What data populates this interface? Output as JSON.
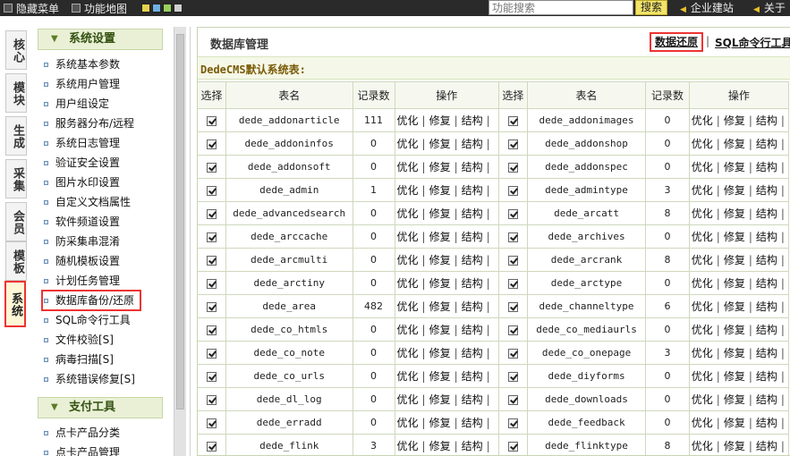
{
  "topbar": {
    "hide_menu": "隐藏菜单",
    "function_map": "功能地图",
    "search_placeholder": "功能搜索",
    "search_button": "搜索",
    "enterprise": "企业建站",
    "about": "关于"
  },
  "vtabs": [
    "核心",
    "模块",
    "生成",
    "采集",
    "会员",
    "模板",
    "系统"
  ],
  "active_vtab": "系统",
  "menu": {
    "section1": "系统设置",
    "items": [
      "系统基本参数",
      "系统用户管理",
      "用户组设定",
      "服务器分布/远程",
      "系统日志管理",
      "验证安全设置",
      "图片水印设置",
      "自定义文档属性",
      "软件频道设置",
      "防采集串混淆",
      "随机模板设置",
      "计划任务管理",
      "数据库备份/还原",
      "SQL命令行工具",
      "文件校验[S]",
      "病毒扫描[S]",
      "系统错误修复[S]"
    ],
    "highlighted": "数据库备份/还原",
    "section2": "支付工具",
    "items2": [
      "点卡产品分类",
      "点卡产品管理"
    ]
  },
  "main": {
    "title": "数据库管理",
    "restore_link": "数据还原",
    "separator": "|",
    "sql_link": "SQL命令行工具",
    "subtitle": "DedeCMS默认系统表:",
    "headers": [
      "选择",
      "表名",
      "记录数",
      "操作",
      "选择",
      "表名",
      "记录数",
      "操作"
    ],
    "ops": [
      "优化",
      "修复",
      "结构"
    ],
    "rows": [
      {
        "a": "dede_addonarticle",
        "ac": "111",
        "b": "dede_addonimages",
        "bc": "0"
      },
      {
        "a": "dede_addoninfos",
        "ac": "0",
        "b": "dede_addonshop",
        "bc": "0"
      },
      {
        "a": "dede_addonsoft",
        "ac": "0",
        "b": "dede_addonspec",
        "bc": "0"
      },
      {
        "a": "dede_admin",
        "ac": "1",
        "b": "dede_admintype",
        "bc": "3"
      },
      {
        "a": "dede_advancedsearch",
        "ac": "0",
        "b": "dede_arcatt",
        "bc": "8"
      },
      {
        "a": "dede_arccache",
        "ac": "0",
        "b": "dede_archives",
        "bc": "0"
      },
      {
        "a": "dede_arcmulti",
        "ac": "0",
        "b": "dede_arcrank",
        "bc": "8"
      },
      {
        "a": "dede_arctiny",
        "ac": "0",
        "b": "dede_arctype",
        "bc": "0"
      },
      {
        "a": "dede_area",
        "ac": "482",
        "b": "dede_channeltype",
        "bc": "6"
      },
      {
        "a": "dede_co_htmls",
        "ac": "0",
        "b": "dede_co_mediaurls",
        "bc": "0"
      },
      {
        "a": "dede_co_note",
        "ac": "0",
        "b": "dede_co_onepage",
        "bc": "3"
      },
      {
        "a": "dede_co_urls",
        "ac": "0",
        "b": "dede_diyforms",
        "bc": "0"
      },
      {
        "a": "dede_dl_log",
        "ac": "0",
        "b": "dede_downloads",
        "bc": "0"
      },
      {
        "a": "dede_erradd",
        "ac": "0",
        "b": "dede_feedback",
        "bc": "0"
      },
      {
        "a": "dede_flink",
        "ac": "3",
        "b": "dede_flinktype",
        "bc": "8"
      }
    ]
  }
}
